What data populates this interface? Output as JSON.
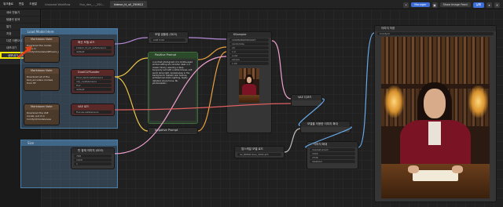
{
  "menu_bar": {
    "menus": [
      "워크플로",
      "편집",
      "도움말"
    ],
    "tabs": [
      "Unsaved Workflow",
      "flux_dev_..._250...",
      "kideon_tt_ull_250612"
    ],
    "active_tab_index": 2,
    "manager_label": "Manager",
    "show_image_feed_label": "Show Image Feed",
    "run_label": "실행"
  },
  "side_menu": {
    "items": [
      "새로 만들기",
      "템플릿 탐색",
      "열기",
      "저장",
      "다른 이름으로 저장",
      "내보내기",
      "내보내기 (API)"
    ],
    "highlighted_index": 6
  },
  "groups": {
    "model_group": "Load Model Here",
    "size_group": "Size"
  },
  "nodes": {
    "unet_loader": {
      "title": "확산 모델 로드",
      "rows": [
        "kideon_tt_ull_safetensors",
        "default"
      ]
    },
    "dual_clip": {
      "title": "DualCLIPLoader",
      "rows": [
        "t5xxl_fp16.safetensors",
        "clip_l.safetensors",
        "flux",
        "default"
      ]
    },
    "vae_loader": {
      "title": "VAE 로드",
      "rows": [
        "flux.ae.safetensors"
      ]
    },
    "note1": {
      "title": "Markdown Note",
      "text": "Download the model, place in ComfyUI/models/diffusion_models"
    },
    "note2": {
      "title": "Markdown Note",
      "text": "Download all of the text_encoders models from HF"
    },
    "note3": {
      "title": "Markdown Note",
      "text": "Download the VAE model, put it in ComfyUI/models/vae"
    },
    "model_sampling": {
      "title": "모델 샘플링 (SD3)",
      "rows": [
        "shift 3.00"
      ]
    },
    "positive_prompt": {
      "title": "Positive Prompt",
      "text": "A portrait photograph of a middle-aged woman sitting at a wooden desk in a classic library, wearing a deep burgundy suit with a white blouse, soft warm lamp light, bookshelves in the background, realistic skin texture, professional studio lighting, highly detailed, sharp focus, 8k, photorealistic."
    },
    "negative_prompt": {
      "title": "Negative Prompt"
    },
    "ksampler": {
      "title": "KSampler",
      "rows": [
        "1000508005820927",
        "randomize",
        "20",
        "1.0",
        "euler",
        "simple",
        "1.00"
      ]
    },
    "empty_latent": {
      "title": "빈 잠재 이미지 (SD3)",
      "rows": [
        "768",
        "1024",
        "1"
      ]
    },
    "vae_decode": {
      "title": "VAE 디코드"
    },
    "upscale_model_loader": {
      "title": "업스케일 모델 로드",
      "rows": [
        "4x_NMKD-Siax_200k.pth"
      ]
    },
    "upscale_with_model": {
      "title": "모델을 이용한 이미지 확대"
    },
    "image_scale": {
      "title": "이미지 확대",
      "rows": [
        "nearest-exact",
        "1024",
        "1536",
        "disabled"
      ]
    },
    "save_image": {
      "title": "이미지 저장",
      "rows": [
        "ComfyUI"
      ]
    }
  },
  "colors": {
    "highlight": "#f2e600",
    "arrow": "#e0421a",
    "link_model": "#b58bd8",
    "link_clip": "#e8c34a",
    "link_vae": "#e06060",
    "link_latent": "#f0a0d0",
    "link_image": "#68a8e8",
    "link_cond": "#e8a040"
  }
}
